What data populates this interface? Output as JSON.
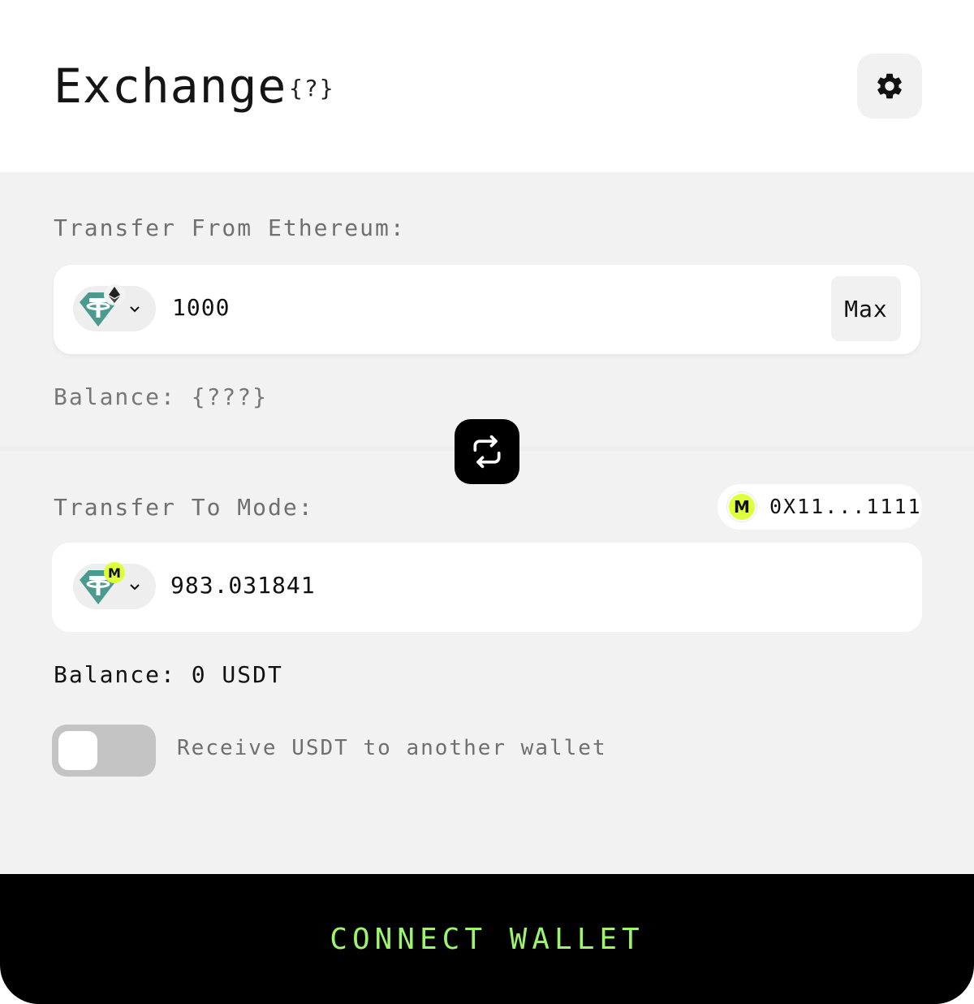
{
  "header": {
    "title": "Exchange",
    "help": "{?}",
    "settings_icon": "gear-icon"
  },
  "from": {
    "label": "Transfer From Ethereum:",
    "token_icon": "usdt-icon",
    "network_badge_icon": "ethereum-icon",
    "amount": "1000",
    "max_label": "Max",
    "balance": "Balance: {???}"
  },
  "swap": {
    "icon": "swap-arrows-icon"
  },
  "to": {
    "label": "Transfer To Mode:",
    "address": "0X11...1111",
    "address_badge": "M",
    "token_icon": "usdt-icon",
    "network_badge": "M",
    "amount": "983.031841",
    "balance": "Balance: 0 USDT"
  },
  "toggle": {
    "label": "Receive USDT to another wallet",
    "enabled": false
  },
  "connect": {
    "label": "CONNECT WALLET"
  },
  "colors": {
    "accent_green": "#9cf56d",
    "mode_yellow": "#dfff3a",
    "tether_teal": "#4a9a8f",
    "panel_bg": "#f2f2f2"
  }
}
